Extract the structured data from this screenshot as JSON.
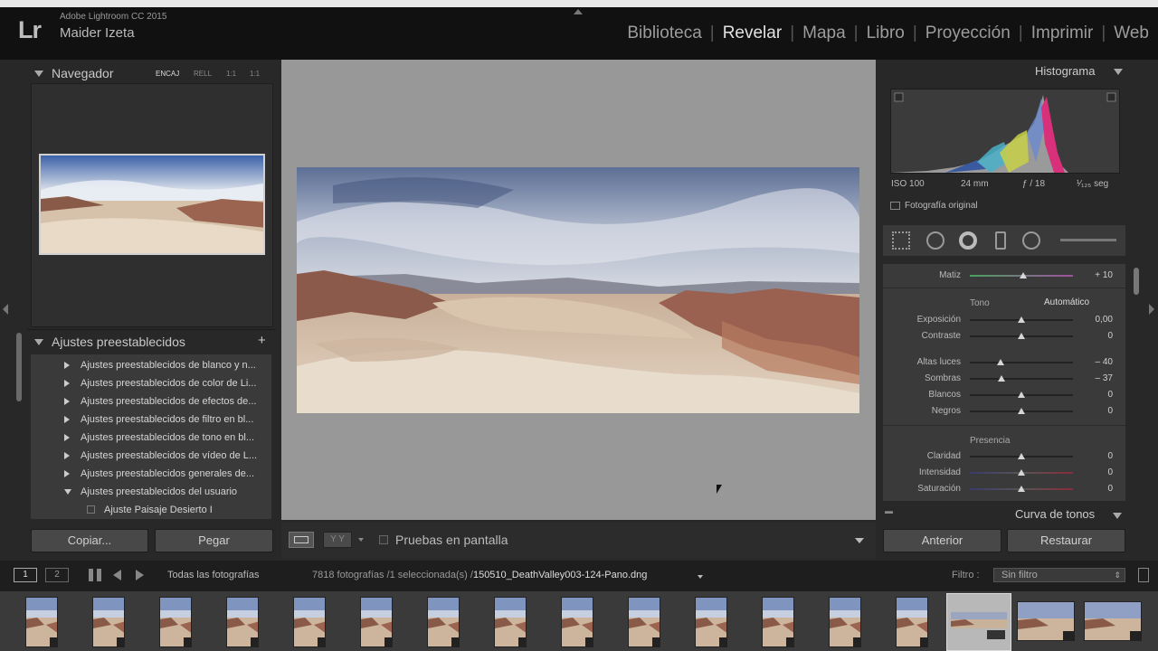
{
  "app": {
    "product": "Adobe Lightroom CC 2015",
    "logo": "Lr",
    "user": "Maider Izeta"
  },
  "modules": [
    {
      "label": "Biblioteca",
      "active": false
    },
    {
      "label": "Revelar",
      "active": true
    },
    {
      "label": "Mapa",
      "active": false
    },
    {
      "label": "Libro",
      "active": false
    },
    {
      "label": "Proyección",
      "active": false
    },
    {
      "label": "Imprimir",
      "active": false
    },
    {
      "label": "Web",
      "active": false
    }
  ],
  "navigator": {
    "title": "Navegador",
    "zoom_options": [
      "ENCAJ",
      "RELL",
      "1:1",
      "1:1"
    ]
  },
  "presets": {
    "title": "Ajustes preestablecidos",
    "add": "+",
    "items": [
      "Ajustes preestablecidos de blanco y n...",
      "Ajustes preestablecidos de color de Li...",
      "Ajustes preestablecidos de efectos de...",
      "Ajustes preestablecidos de filtro en bl...",
      "Ajustes preestablecidos de tono en bl...",
      "Ajustes preestablecidos de vídeo de L...",
      "Ajustes preestablecidos generales de...",
      "Ajustes preestablecidos del usuario"
    ],
    "user_preset": "Ajuste Paisaje Desierto I"
  },
  "left_buttons": {
    "copy": "Copiar...",
    "paste": "Pegar"
  },
  "toolbar": {
    "yy": "Y Y",
    "soft_proof": "Pruebas en pantalla"
  },
  "histogram": {
    "title": "Histograma",
    "iso": "ISO 100",
    "focal": "24 mm",
    "aperture": "ƒ / 18",
    "shutter": "¹⁄₁₂₅ seg",
    "original": "Fotografía original"
  },
  "basic": {
    "tint": {
      "label": "Matiz",
      "value": "+ 10",
      "pos": 0.52
    },
    "tone_label": "Tono",
    "auto_label": "Automático",
    "tone_sliders": [
      {
        "label": "Exposición",
        "value": "0,00",
        "pos": 0.5
      },
      {
        "label": "Contraste",
        "value": "0",
        "pos": 0.5
      },
      {
        "label": "Altas luces",
        "value": "– 40",
        "pos": 0.3
      },
      {
        "label": "Sombras",
        "value": "– 37",
        "pos": 0.31
      },
      {
        "label": "Blancos",
        "value": "0",
        "pos": 0.5
      },
      {
        "label": "Negros",
        "value": "0",
        "pos": 0.5
      }
    ],
    "presence_label": "Presencia",
    "presence_sliders": [
      {
        "label": "Claridad",
        "value": "0",
        "pos": 0.5
      },
      {
        "label": "Intensidad",
        "value": "0",
        "pos": 0.5
      },
      {
        "label": "Saturación",
        "value": "0",
        "pos": 0.5
      }
    ]
  },
  "tone_curve": {
    "title": "Curva de tonos"
  },
  "right_buttons": {
    "previous": "Anterior",
    "reset": "Restaurar"
  },
  "filmbar": {
    "page1": "1",
    "page2": "2",
    "source": "Todas las fotografías",
    "count": "7818 fotografías /1 seleccionada(s) /",
    "filename": "150510_DeathValley003-124-Pano.dng",
    "filter_label": "Filtro :",
    "filter_value": "Sin filtro"
  },
  "colors": {
    "accent_active": "#e2e2e2",
    "panel": "#3a3a3a",
    "background": "#282828"
  }
}
